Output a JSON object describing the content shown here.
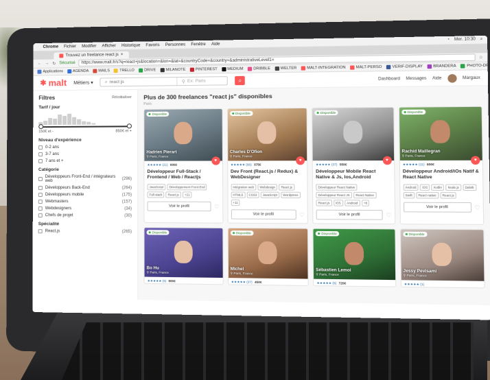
{
  "menubar": {
    "apple": "",
    "app": "Chrome",
    "items": [
      "Fichier",
      "Modifier",
      "Afficher",
      "Historique",
      "Favoris",
      "Personnes",
      "Fenêtre",
      "Aide"
    ],
    "clock": "Mer. 10:30"
  },
  "tab": {
    "title": "Trouvez un freelance react js"
  },
  "address": {
    "secure_label": "Sécurisé",
    "url": "https://www.malt.fr/s?q=react+js&location=&lon=&lat=&countryCode=&country=&administrativeLevel1="
  },
  "bookmarks": [
    {
      "label": "Applications",
      "color": "#4a7bd0"
    },
    {
      "label": "AGENDA",
      "color": "#2e6fd8"
    },
    {
      "label": "MAILS",
      "color": "#d64a3a"
    },
    {
      "label": "TRELLO",
      "color": "#f2c230"
    },
    {
      "label": "DRIVE",
      "color": "#2aa34a"
    },
    {
      "label": "MILANOTE",
      "color": "#333333"
    },
    {
      "label": "PINTEREST",
      "color": "#c8232c"
    },
    {
      "label": "MEDIUM",
      "color": "#111111"
    },
    {
      "label": "DRIBBLE",
      "color": "#ea4c89"
    },
    {
      "label": "WELTER",
      "color": "#444444"
    },
    {
      "label": "MALT-INTEGRATION",
      "color": "#fc5757"
    },
    {
      "label": "MALT-PERSO",
      "color": "#fc5757"
    },
    {
      "label": "VERIF-DISPLAY",
      "color": "#3b5998"
    },
    {
      "label": "BRANDERA",
      "color": "#a040c0"
    },
    {
      "label": "PHOTO-DRIVE",
      "color": "#2aa34a"
    },
    {
      "label": "ANKITE",
      "color": "#e8a020"
    }
  ],
  "header": {
    "logo": "malt",
    "metiers": "Métiers",
    "search_value": "react js",
    "location_placeholder": "Ex: Paris",
    "dashboard": "Dashboard",
    "messages": "Messages",
    "aide": "Aide",
    "user": "Margaux"
  },
  "sidebar": {
    "title": "Filtres",
    "reset": "Réinitialiser",
    "tarif_title": "Tarif / jour",
    "histogram": [
      0.2,
      0.35,
      0.55,
      0.5,
      0.85,
      0.7,
      0.9,
      0.6,
      0.45,
      0.3,
      0.2,
      0.1
    ],
    "range_min": "150€ et -",
    "range_max": "850€ et +",
    "experience_title": "Niveau d'expérience",
    "experience": [
      "0-2 ans",
      "3-7 ans",
      "7 ans et +"
    ],
    "categorie_title": "Catégorie",
    "categories": [
      {
        "label": "Développeurs Front-End / intégrateurs web",
        "count": "(296)"
      },
      {
        "label": "Développeurs Back-End",
        "count": "(264)"
      },
      {
        "label": "Développeurs mobile",
        "count": "(175)"
      },
      {
        "label": "Webmasters",
        "count": "(157)"
      },
      {
        "label": "Webdesigners",
        "count": "(34)"
      },
      {
        "label": "Chefs de projet",
        "count": "(30)"
      }
    ],
    "specialite_title": "Spécialité",
    "specialites": [
      {
        "label": "React.js",
        "count": "(265)"
      }
    ]
  },
  "main": {
    "title": "Plus de 300 freelances \"react js\" disponibles",
    "subtitle": "Paris",
    "badge": "Disponible",
    "voir": "Voir le profil",
    "cards": [
      {
        "name": "Hadrien Pierart",
        "location": "Paris, France",
        "rating": "★★★★★ (21)",
        "price": "600€",
        "title": "Développeur Full-Stack / Frontend / Web / Reactjs",
        "tags": [
          "JavaScript",
          "Développement Front-End",
          "Full-stack",
          "React.js",
          "+21"
        ]
      },
      {
        "name": "Charles D'Ofion",
        "location": "Paris, France",
        "rating": "★★★★★ (96)",
        "price": "375€",
        "title": "Dev Front (React.js / Redux) & WebDesigner",
        "tags": [
          "Intégration web",
          "Webdesign",
          "React.js",
          "HTML5",
          "CSS3",
          "JavaScript",
          "Wordpress",
          "+11"
        ]
      },
      {
        "name": "",
        "location": "",
        "rating": "★★★★★ (37)",
        "price": "550€",
        "title": "Développeur Mobile React Native & Js, Ios,Android",
        "tags": [
          "Développeur React Native",
          "Développeur React JS",
          "React Native",
          "React.js",
          "iOS",
          "Android",
          "+8"
        ]
      },
      {
        "name": "Rachid Maillegran",
        "location": "Paris, France",
        "rating": "★★★★★ (11)",
        "price": "600€",
        "title": "Développeur Android/iOs Natif & React Native",
        "tags": [
          "Android",
          "iOS",
          "Kotlin",
          "Node.js",
          "Dalvik",
          "Swift",
          "React native",
          "React.js"
        ]
      },
      {
        "name": "Bo Hu",
        "location": "Paris, France",
        "rating": "★★★★★ (6)",
        "price": "900€",
        "title": "",
        "tags": []
      },
      {
        "name": "Michel",
        "location": "Paris, France",
        "rating": "★★★★★ (37)",
        "price": "450€",
        "title": "",
        "tags": []
      },
      {
        "name": "Sébastien Lemoi",
        "location": "Paris, France",
        "rating": "★★★★★ (6)",
        "price": "720€",
        "title": "",
        "tags": []
      },
      {
        "name": "Jessy Pevisami",
        "location": "Paris, France",
        "rating": "★★★★★ (1)",
        "price": "",
        "title": "",
        "tags": []
      }
    ]
  }
}
